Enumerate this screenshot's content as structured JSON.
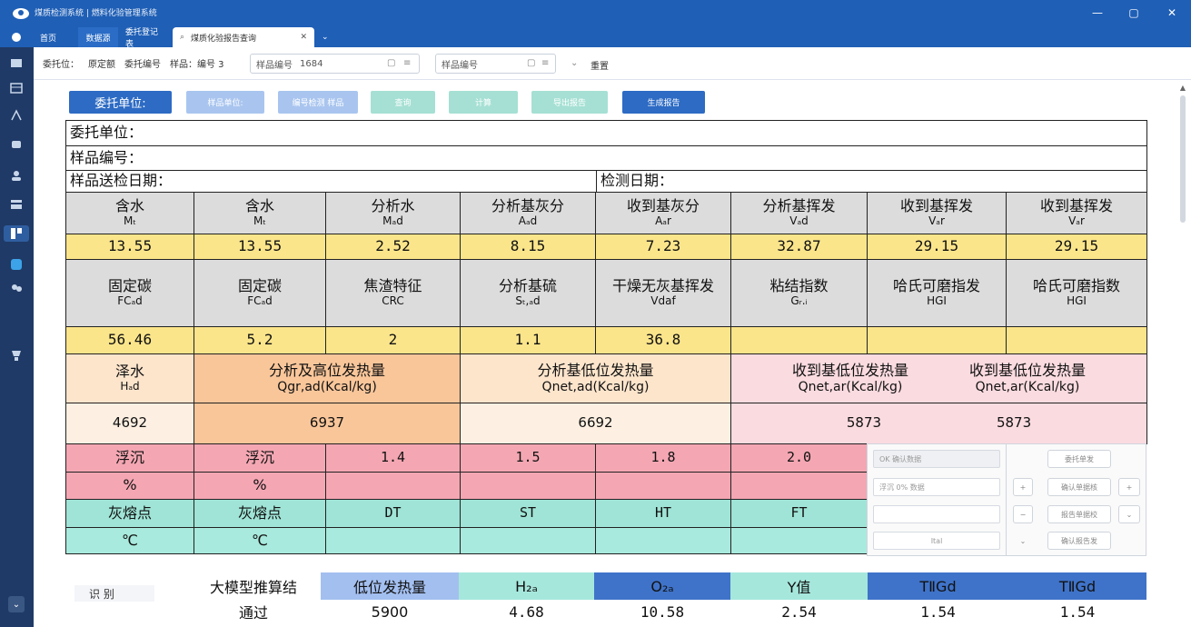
{
  "titlebar": {
    "title": "煤质检测系统 | 燃料化验管理系统"
  },
  "tabs": [
    {
      "label": "首页"
    },
    {
      "label": "数据源"
    },
    {
      "label": "委托登记表"
    },
    {
      "label": "煤质化验报告查询"
    }
  ],
  "filters": {
    "client_label": "委托位：",
    "client_value": "原定额",
    "commission_label": "委托编号",
    "sample_label": "样品：",
    "sample_value": "编号 3",
    "sample_no_label": "样品编号",
    "sample_no_value": "1684",
    "second_input": "样品编号",
    "extra": "重置"
  },
  "buttons": [
    {
      "label": "委托单位:",
      "color": "#2d6bc4"
    },
    {
      "label": "样品单位:",
      "color": "#a9c5ef"
    },
    {
      "label": "编号检测 样品",
      "color": "#a9c5ef"
    },
    {
      "label": "查询",
      "color": "#a6e0d4"
    },
    {
      "label": "计算",
      "color": "#a6e0d4"
    },
    {
      "label": "导出报告",
      "color": "#a6e0d4"
    },
    {
      "label": "生成报告",
      "color": "#2d6bc4"
    }
  ],
  "info": {
    "client": "委托单位：",
    "sample_no": "样品编号：",
    "send_date": "样品送检日期：",
    "test_date": "检测日期："
  },
  "row1": [
    {
      "name": "含水",
      "sym": "Mₜ"
    },
    {
      "name": "含水",
      "sym": "Mₜ"
    },
    {
      "name": "分析水",
      "sym": "Mₐd"
    },
    {
      "name": "分析基灰分",
      "sym": "Aₐd"
    },
    {
      "name": "收到基灰分",
      "sym": "Aₐr"
    },
    {
      "name": "分析基挥发",
      "sym": "Vₐd"
    },
    {
      "name": "收到基挥发",
      "sym": "Vₐr"
    },
    {
      "name": "收到基挥发",
      "sym": "Vₐr"
    }
  ],
  "row1_vals": [
    "13.55",
    "13.55",
    "2.52",
    "8.15",
    "7.23",
    "32.87",
    "29.15",
    "29.15"
  ],
  "row2": [
    {
      "name": "固定碳",
      "sym": "FCₐd"
    },
    {
      "name": "固定碳",
      "sym": "FCₐd"
    },
    {
      "name": "焦渣特征",
      "sym": "CRC"
    },
    {
      "name": "分析基硫",
      "sym": "Sₜ,ₐd"
    },
    {
      "name": "干燥无灰基挥发",
      "sym": "Vdaf"
    },
    {
      "name": "粘结指数",
      "sym": "Gᵣ.ᵢ"
    },
    {
      "name": "哈氏可磨指发",
      "sym": "HGI"
    },
    {
      "name": "哈氏可磨指数",
      "sym": "HGI"
    }
  ],
  "row2_vals": [
    "56.46",
    "5.2",
    "2",
    "1.1",
    "36.8",
    "",
    "",
    ""
  ],
  "heat": {
    "h_name": "泽水",
    "h_sym": "Hₐd",
    "gross_name": "分析及高位发热量",
    "gross_sym": "Qgr,ad(Kcal/kg)",
    "net_ad_name": "分析基低位发热量",
    "net_ad_sym": "Qnet,ad(Kcal/kg)",
    "net_ar_name": "收到基低位发热量",
    "net_ar_sym": "Qnet,ar(Kcal/kg)",
    "net_ar2_name": "收到基低位发热量",
    "net_ar2_sym": "Qnet,ar(Kcal/kg)",
    "h_val": "4692",
    "gross_val": "6937",
    "net_ad_val": "6692",
    "net_ar_val": "5873",
    "net_ar2_val": "5873"
  },
  "float": {
    "a": "浮沉",
    "b": "浮沉",
    "c": "1.4",
    "d": "1.5",
    "e": "1.8",
    "f": "2.0",
    "u1": "%",
    "u2": "%"
  },
  "ash": {
    "a": "灰熔点",
    "b": "灰熔点",
    "c": "DT",
    "d": "ST",
    "e": "HT",
    "f": "FT",
    "u1": "℃",
    "u2": "℃"
  },
  "controls": {
    "in1": "OK  确认数据",
    "in2": "浮沉   0%  数据",
    "in3": "",
    "in4": "Ital",
    "b1": "委托单发",
    "b2": "确认单据核",
    "b3": "报告单据校",
    "b4": "确认报告发",
    "plus": "+",
    "minus": "−",
    "chev": "⌄"
  },
  "bottom": {
    "left_label": "识 别",
    "model_title": "大模型推算结",
    "model_result": "通过",
    "heads": [
      "低位发热量",
      "H₂ₐ",
      "O₂ₐ",
      "Y值",
      "TⅡGd",
      "TⅡGd"
    ],
    "head_colors": [
      "#a3bff0",
      "#a6e7dc",
      "#3f73c9",
      "#a6e7dc",
      "#3f73c9",
      "#3f73c9"
    ],
    "vals": [
      "5900",
      "4.68",
      "10.58",
      "2.54",
      "1.54",
      "1.54"
    ]
  }
}
